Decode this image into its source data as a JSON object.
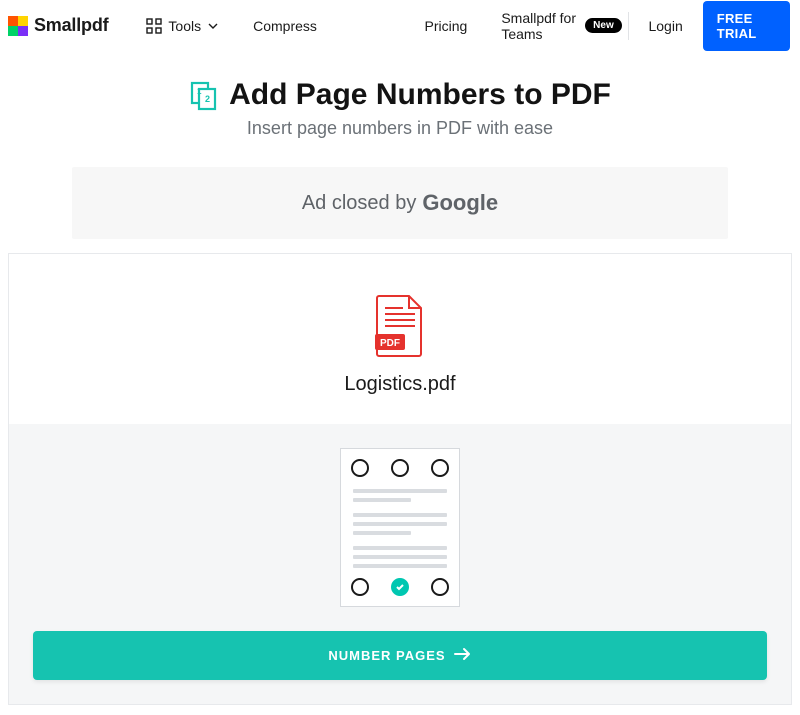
{
  "header": {
    "brand": "Smallpdf",
    "tools_label": "Tools",
    "compress_label": "Compress",
    "pricing_label": "Pricing",
    "teams_label": "Smallpdf for Teams",
    "teams_badge": "New",
    "login_label": "Login",
    "cta_label": "FREE TRIAL"
  },
  "hero": {
    "title": "Add Page Numbers to PDF",
    "subtitle": "Insert page numbers in PDF with ease"
  },
  "ad": {
    "prefix": "Ad closed by",
    "provider": "Google"
  },
  "file": {
    "name": "Logistics.pdf",
    "badge": "PDF"
  },
  "picker": {
    "positions": [
      "top-left",
      "top-center",
      "top-right",
      "bottom-left",
      "bottom-center",
      "bottom-right"
    ],
    "selected": "bottom-center"
  },
  "action": {
    "label": "NUMBER PAGES"
  },
  "colors": {
    "primary_blue": "#0061ff",
    "accent_teal": "#16c3b0",
    "selected_teal": "#00c7b1",
    "pdf_red": "#e5322d"
  }
}
